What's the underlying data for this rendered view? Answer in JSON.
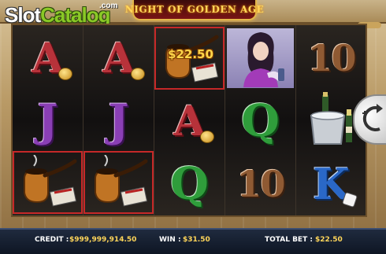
{
  "logo": {
    "slot": "Slot",
    "catalog": "Catalog",
    "com": ".com"
  },
  "game_title": "NIGHT OF GOLDEN AGE",
  "win_payout": "$22.50",
  "reels": [
    [
      "A",
      "J",
      "pipe"
    ],
    [
      "A",
      "J",
      "pipe"
    ],
    [
      "pipe",
      "A",
      "Q"
    ],
    [
      "lady",
      "Q",
      "10"
    ],
    [
      "10",
      "champagne",
      "K"
    ]
  ],
  "symbol_text": {
    "A": "A",
    "J": "J",
    "Q": "Q",
    "K": "K",
    "ten": "10"
  },
  "status_bar": {
    "credit_label": "CREDIT :",
    "credit_value": "$999,999,914.50",
    "win_label": "WIN :",
    "win_value": "$31.50",
    "total_bet_label": "TOTAL BET :",
    "total_bet_value": "$22.50"
  },
  "colors": {
    "A": "#b7323a",
    "J": "#8a3fb5",
    "Q": "#2f9d3b",
    "K": "#2a68c7",
    "ten": "#8f5a33",
    "win_frame": "#c62828",
    "title_gold": "#ffd65a"
  },
  "icons": [
    "pipe-icon",
    "matchbox-icon",
    "coins-icon",
    "champagne-bucket-icon",
    "dice-icon",
    "lady-character",
    "spin-button-icon"
  ]
}
